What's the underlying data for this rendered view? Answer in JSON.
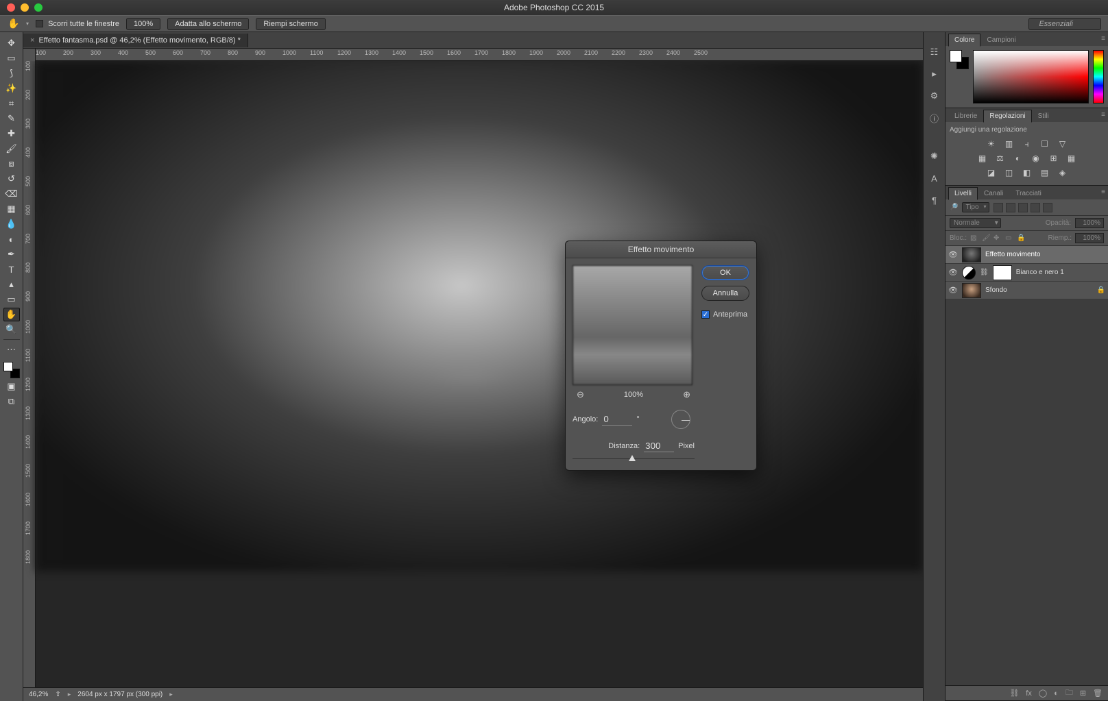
{
  "app": {
    "title": "Adobe Photoshop CC 2015"
  },
  "options_bar": {
    "scroll_all_label": "Scorri tutte le finestre",
    "zoom_display": "100%",
    "fit_screen": "Adatta allo schermo",
    "fill_screen": "Riempi schermo",
    "workspace": "Essenziali"
  },
  "document": {
    "tab_title": "Effetto fantasma.psd @ 46,2% (Effetto movimento, RGB/8) *",
    "ruler_h": [
      "100",
      "200",
      "300",
      "400",
      "500",
      "600",
      "700",
      "800",
      "900",
      "1000",
      "1100",
      "1200",
      "1300",
      "1400",
      "1500",
      "1600",
      "1700",
      "1800",
      "1900",
      "2000",
      "2100",
      "2200",
      "2300",
      "2400",
      "2500"
    ],
    "ruler_v": [
      "100",
      "200",
      "300",
      "400",
      "500",
      "600",
      "700",
      "800",
      "900",
      "1000",
      "1100",
      "1200",
      "1300",
      "1400",
      "1500",
      "1600",
      "1700",
      "1800"
    ]
  },
  "statusbar": {
    "zoom": "46,2%",
    "dims": "2604 px x 1797 px (300 ppi)"
  },
  "panels": {
    "color_tabs": [
      "Colore",
      "Campioni"
    ],
    "adjust_tabs": [
      "Librerie",
      "Regolazioni",
      "Stili"
    ],
    "adjust_hint": "Aggiungi una regolazione",
    "layers_tabs": [
      "Livelli",
      "Canali",
      "Tracciati"
    ],
    "kind_label": "Tipo",
    "blend_mode": "Normale",
    "opacity_label": "Opacità:",
    "opacity_value": "100%",
    "lock_label": "Bloc.:",
    "fill_label": "Riemp.:",
    "fill_value": "100%",
    "layers": [
      {
        "name": "Effetto movimento",
        "selected": true,
        "locked": false,
        "type": "smart"
      },
      {
        "name": "Bianco e nero 1",
        "selected": false,
        "locked": false,
        "type": "adjustment"
      },
      {
        "name": "Sfondo",
        "selected": false,
        "locked": true,
        "type": "background"
      }
    ]
  },
  "dialog": {
    "title": "Effetto movimento",
    "ok": "OK",
    "cancel": "Annulla",
    "preview_label": "Anteprima",
    "preview_checked": true,
    "zoom": "100%",
    "angle_label": "Angolo:",
    "angle_value": "0",
    "angle_unit": "°",
    "distance_label": "Distanza:",
    "distance_value": "300",
    "distance_unit": "Pixel",
    "distance_min": 1,
    "distance_max": 2000
  }
}
